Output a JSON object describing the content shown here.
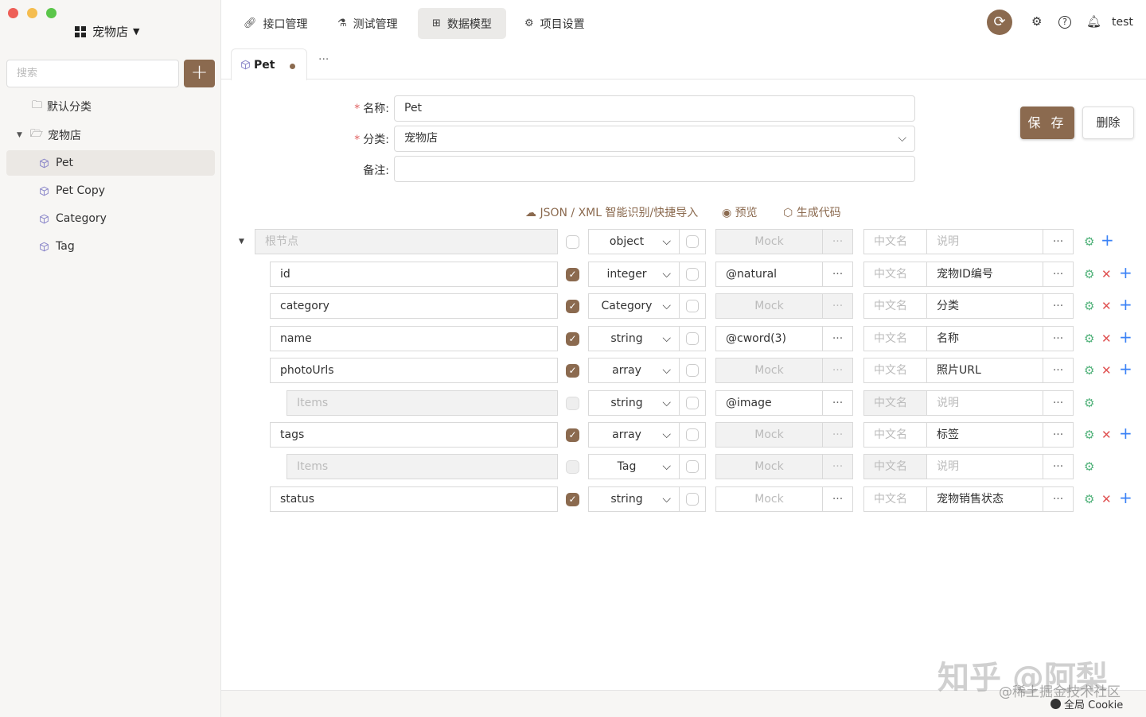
{
  "window": {
    "project_name": "宠物店"
  },
  "sidebar": {
    "search_placeholder": "搜索",
    "tree": {
      "default_folder": "默认分类",
      "folder": "宠物店",
      "models": [
        "Pet",
        "Pet Copy",
        "Category",
        "Tag"
      ]
    }
  },
  "nav": {
    "tabs": [
      "接口管理",
      "测试管理",
      "数据模型",
      "项目设置"
    ],
    "active": "数据模型",
    "user": "test"
  },
  "doc_tabs": {
    "active_tab": "Pet",
    "more": "···"
  },
  "form": {
    "name_label": "名称:",
    "name_value": "Pet",
    "category_label": "分类:",
    "category_value": "宠物店",
    "remark_label": "备注:",
    "remark_value": "",
    "save_label": "保 存",
    "delete_label": "删除"
  },
  "toolbar": {
    "import_label": "JSON / XML 智能识别/快捷导入",
    "preview_label": "预览",
    "codegen_label": "生成代码"
  },
  "schema": {
    "root": {
      "name_placeholder": "根节点",
      "type": "object",
      "mock": "Mock",
      "cn_name_placeholder": "中文名",
      "desc_placeholder": "说明"
    },
    "fields": [
      {
        "name": "id",
        "required": true,
        "type": "integer",
        "mock": "@natural",
        "cn_name": "",
        "desc": "宠物ID编号",
        "level": 1
      },
      {
        "name": "category",
        "required": true,
        "type": "Category",
        "mock": "",
        "cn_name": "",
        "desc": "分类",
        "level": 1
      },
      {
        "name": "name",
        "required": true,
        "type": "string",
        "mock": "@cword(3)",
        "cn_name": "",
        "desc": "名称",
        "level": 1
      },
      {
        "name": "photoUrls",
        "required": true,
        "type": "array",
        "mock": "",
        "cn_name": "",
        "desc": "照片URL",
        "level": 1
      },
      {
        "name": "",
        "items_placeholder": "Items",
        "required": false,
        "type": "string",
        "mock": "@image",
        "cn_name": "",
        "desc": "",
        "level": 2
      },
      {
        "name": "tags",
        "required": true,
        "type": "array",
        "mock": "",
        "cn_name": "",
        "desc": "标签",
        "level": 1
      },
      {
        "name": "",
        "items_placeholder": "Items",
        "required": false,
        "type": "Tag",
        "mock": "",
        "cn_name": "",
        "desc": "",
        "level": 2
      },
      {
        "name": "status",
        "required": true,
        "type": "string",
        "mock": "",
        "cn_name": "",
        "desc": "宠物销售状态",
        "level": 1
      }
    ],
    "mock_placeholder": "Mock",
    "cn_name_placeholder": "中文名",
    "desc_placeholder": "说明",
    "more": "···"
  },
  "statusbar": {
    "cookie_label": "全局 Cookie"
  },
  "watermark": {
    "line1": "知乎 @阿梨",
    "line2": "@稀土掘金技术社区"
  },
  "colors": {
    "accent": "#8b6a4f",
    "settings_icon": "#52b27b",
    "delete_icon": "#e05252",
    "add_icon": "#3b82f6"
  }
}
